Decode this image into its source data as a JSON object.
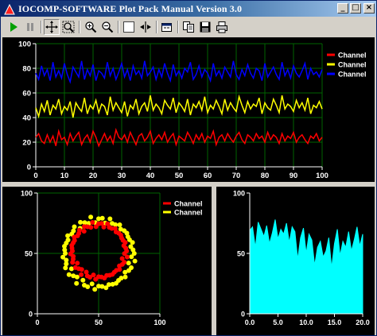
{
  "window": {
    "title": "IOCOMP-SOFTWARE Plot Pack Manual Version 3.0",
    "title_bar_color": "#0a246a"
  },
  "window_controls": {
    "minimize": "_",
    "maximize": "□",
    "close": "×"
  },
  "toolbar": {
    "buttons": [
      {
        "name": "play",
        "icon": "play-icon"
      },
      {
        "name": "pause",
        "icon": "pause-icon"
      },
      {
        "name": "pan",
        "icon": "move-cross-icon"
      },
      {
        "name": "zoom-box",
        "icon": "zoom-box-icon"
      },
      {
        "name": "zoom-in",
        "icon": "zoom-in-icon"
      },
      {
        "name": "zoom-out",
        "icon": "zoom-out-icon"
      },
      {
        "name": "select",
        "icon": "select-box-icon"
      },
      {
        "name": "cursor",
        "icon": "data-cursor-icon"
      },
      {
        "name": "edit",
        "icon": "edit-window-icon"
      },
      {
        "name": "copy",
        "icon": "copy-icon"
      },
      {
        "name": "save",
        "icon": "floppy-icon"
      },
      {
        "name": "print",
        "icon": "printer-icon"
      }
    ]
  },
  "chart_data": [
    {
      "type": "line",
      "xlim": [
        0,
        100
      ],
      "ylim": [
        0,
        100
      ],
      "xticks": [
        "0",
        "10",
        "20",
        "30",
        "40",
        "50",
        "60",
        "70",
        "80",
        "90",
        "100"
      ],
      "yticks": [
        "0",
        "20",
        "40",
        "60",
        "80",
        "100"
      ],
      "grid": true,
      "legend": "top-right",
      "series": [
        {
          "name": "Channel",
          "color": "#ff0000",
          "values": [
            24,
            27,
            21,
            19,
            26,
            20,
            25,
            17,
            29,
            22,
            24,
            18,
            27,
            21,
            25,
            28,
            18,
            23,
            26,
            20,
            29,
            24,
            17,
            22,
            27,
            21,
            25,
            19,
            30,
            24,
            22,
            26,
            20,
            28,
            23,
            18,
            25,
            27,
            21,
            24,
            29,
            19,
            23,
            26,
            22,
            28,
            20,
            24,
            27,
            18,
            25,
            23,
            21,
            28,
            24,
            19,
            26,
            22,
            27,
            20,
            25,
            23,
            29,
            18,
            24,
            26,
            21,
            27,
            23,
            20,
            25,
            28,
            22,
            19,
            26,
            24,
            21,
            27,
            23,
            25,
            20,
            28,
            22,
            26,
            24,
            19,
            27,
            21,
            25,
            23,
            28,
            20,
            24,
            26,
            22,
            19,
            25,
            23,
            27,
            21,
            24
          ]
        },
        {
          "name": "Channel",
          "color": "#ffff00",
          "values": [
            48,
            41,
            51,
            45,
            54,
            42,
            50,
            47,
            55,
            43,
            49,
            46,
            53,
            40,
            52,
            48,
            45,
            56,
            43,
            50,
            47,
            54,
            44,
            51,
            49,
            42,
            57,
            46,
            52,
            48,
            44,
            53,
            41,
            50,
            47,
            55,
            43,
            49,
            52,
            45,
            58,
            46,
            51,
            48,
            43,
            54,
            50,
            47,
            56,
            44,
            52,
            49,
            45,
            55,
            42,
            51,
            48,
            53,
            46,
            57,
            44,
            50,
            47,
            54,
            49,
            43,
            55,
            46,
            52,
            48,
            45,
            57,
            50,
            44,
            53,
            47,
            51,
            49,
            56,
            43,
            52,
            48,
            46,
            55,
            50,
            44,
            58,
            47,
            51,
            49,
            45,
            54,
            48,
            52,
            46,
            56,
            43,
            50,
            48,
            53,
            47
          ]
        },
        {
          "name": "Channel",
          "color": "#0000ff",
          "values": [
            76,
            71,
            82,
            74,
            79,
            70,
            85,
            73,
            78,
            72,
            84,
            75,
            69,
            81,
            77,
            73,
            86,
            71,
            79,
            74,
            83,
            70,
            78,
            76,
            72,
            85,
            74,
            80,
            71,
            77,
            84,
            73,
            79,
            70,
            82,
            75,
            78,
            72,
            86,
            74,
            77,
            81,
            71,
            79,
            73,
            84,
            76,
            70,
            83,
            74,
            78,
            72,
            80,
            77,
            85,
            71,
            75,
            82,
            73,
            79,
            76,
            70,
            84,
            74,
            78,
            72,
            81,
            77,
            73,
            86,
            75,
            71,
            79,
            74,
            83,
            76,
            72,
            80,
            78,
            70,
            84,
            73,
            77,
            81,
            75,
            71,
            85,
            74,
            79,
            72,
            82,
            76,
            73,
            78,
            84,
            71,
            80,
            75,
            77,
            73,
            79
          ]
        }
      ]
    },
    {
      "type": "scatter",
      "xlim": [
        0,
        100
      ],
      "ylim": [
        0,
        100
      ],
      "xticks": [
        "0",
        "50",
        "100"
      ],
      "yticks": [
        "0",
        "50",
        "100"
      ],
      "grid": true,
      "legend": "top-right",
      "series": [
        {
          "name": "Channel",
          "color": "#ff0000",
          "shape": "ring",
          "center": [
            50,
            52
          ],
          "radius": [
            22,
            22
          ]
        },
        {
          "name": "Channel",
          "color": "#ffff00",
          "shape": "ring",
          "center": [
            50,
            50
          ],
          "radius": [
            28,
            28
          ]
        }
      ]
    },
    {
      "type": "area",
      "xlim": [
        0,
        20
      ],
      "ylim": [
        0,
        100
      ],
      "xticks": [
        "0.0",
        "5.0",
        "10.0",
        "15.0",
        "20.0"
      ],
      "yticks": [
        "0",
        "50",
        "100"
      ],
      "grid": false,
      "fill": "#00ffff",
      "x": [
        0,
        0.5,
        1,
        1.5,
        2,
        2.5,
        3,
        3.5,
        4,
        4.5,
        5,
        5.5,
        6,
        6.5,
        7,
        7.5,
        8,
        8.5,
        9,
        9.5,
        10,
        10.5,
        11,
        11.5,
        12,
        12.5,
        13,
        13.5,
        14,
        14.5,
        15,
        15.5,
        16,
        16.5,
        17,
        17.5,
        18,
        18.5,
        19,
        19.5,
        20
      ],
      "values": [
        69,
        72,
        55,
        76,
        70,
        64,
        73,
        58,
        67,
        78,
        62,
        70,
        66,
        75,
        59,
        72,
        68,
        45,
        63,
        71,
        50,
        66,
        61,
        40,
        55,
        60,
        47,
        52,
        63,
        38,
        58,
        70,
        48,
        60,
        55,
        68,
        52,
        61,
        72,
        56,
        66
      ]
    }
  ]
}
